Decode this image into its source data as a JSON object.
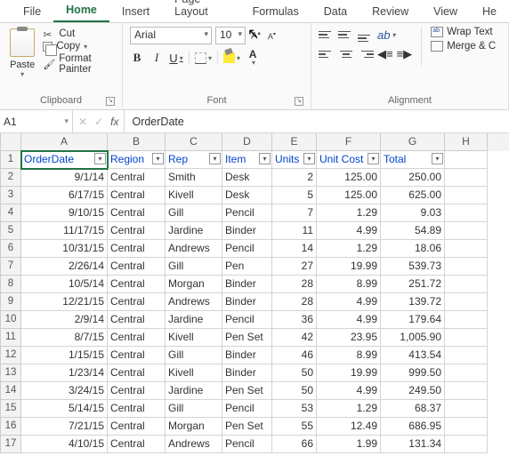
{
  "tabs": [
    "File",
    "Home",
    "Insert",
    "Page Layout",
    "Formulas",
    "Data",
    "Review",
    "View",
    "He"
  ],
  "active_tab": 1,
  "clipboard": {
    "paste": "Paste",
    "cut": "Cut",
    "copy": "Copy",
    "format_painter": "Format Painter",
    "group_label": "Clipboard"
  },
  "font": {
    "name": "Arial",
    "size": "10",
    "increase": "A",
    "decrease": "A",
    "bold": "B",
    "italic": "I",
    "underline": "U",
    "fontcolor_letter": "A",
    "group_label": "Font"
  },
  "alignment": {
    "wrap": "Wrap Text",
    "merge": "Merge & C",
    "group_label": "Alignment"
  },
  "namebox": "A1",
  "formula_value": "OrderDate",
  "columns": [
    "A",
    "B",
    "C",
    "D",
    "E",
    "F",
    "G",
    "H"
  ],
  "headers": [
    "OrderDate",
    "Region",
    "Rep",
    "Item",
    "Units",
    "Unit Cost",
    "Total"
  ],
  "chart_data": {
    "type": "table",
    "columns": [
      "OrderDate",
      "Region",
      "Rep",
      "Item",
      "Units",
      "Unit Cost",
      "Total"
    ],
    "rows": [
      [
        "9/1/14",
        "Central",
        "Smith",
        "Desk",
        "2",
        "125.00",
        "250.00"
      ],
      [
        "6/17/15",
        "Central",
        "Kivell",
        "Desk",
        "5",
        "125.00",
        "625.00"
      ],
      [
        "9/10/15",
        "Central",
        "Gill",
        "Pencil",
        "7",
        "1.29",
        "9.03"
      ],
      [
        "11/17/15",
        "Central",
        "Jardine",
        "Binder",
        "11",
        "4.99",
        "54.89"
      ],
      [
        "10/31/15",
        "Central",
        "Andrews",
        "Pencil",
        "14",
        "1.29",
        "18.06"
      ],
      [
        "2/26/14",
        "Central",
        "Gill",
        "Pen",
        "27",
        "19.99",
        "539.73"
      ],
      [
        "10/5/14",
        "Central",
        "Morgan",
        "Binder",
        "28",
        "8.99",
        "251.72"
      ],
      [
        "12/21/15",
        "Central",
        "Andrews",
        "Binder",
        "28",
        "4.99",
        "139.72"
      ],
      [
        "2/9/14",
        "Central",
        "Jardine",
        "Pencil",
        "36",
        "4.99",
        "179.64"
      ],
      [
        "8/7/15",
        "Central",
        "Kivell",
        "Pen Set",
        "42",
        "23.95",
        "1,005.90"
      ],
      [
        "1/15/15",
        "Central",
        "Gill",
        "Binder",
        "46",
        "8.99",
        "413.54"
      ],
      [
        "1/23/14",
        "Central",
        "Kivell",
        "Binder",
        "50",
        "19.99",
        "999.50"
      ],
      [
        "3/24/15",
        "Central",
        "Jardine",
        "Pen Set",
        "50",
        "4.99",
        "249.50"
      ],
      [
        "5/14/15",
        "Central",
        "Gill",
        "Pencil",
        "53",
        "1.29",
        "68.37"
      ],
      [
        "7/21/15",
        "Central",
        "Morgan",
        "Pen Set",
        "55",
        "12.49",
        "686.95"
      ],
      [
        "4/10/15",
        "Central",
        "Andrews",
        "Pencil",
        "66",
        "1.99",
        "131.34"
      ]
    ]
  }
}
